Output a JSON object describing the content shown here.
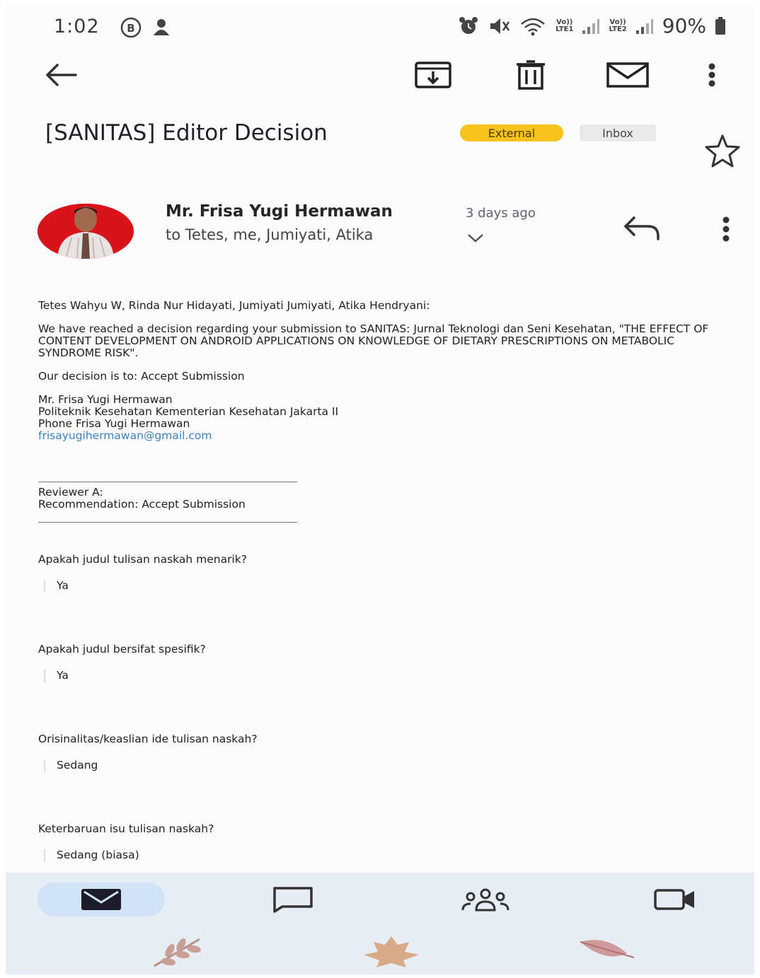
{
  "status_bar": {
    "time": "1:02",
    "sim1": {
      "top": "Vo))",
      "bottom": "LTE1"
    },
    "sim2": {
      "top": "Vo))",
      "bottom": "LTE2"
    },
    "battery": "90%"
  },
  "toolbar": {
    "back": "arrow-left-icon",
    "archive": "archive-icon",
    "delete": "trash-icon",
    "mark_unread": "mail-icon",
    "more": "more-vertical-icon"
  },
  "email": {
    "subject": "[SANITAS] Editor Decision",
    "labels": {
      "external": "External",
      "inbox": "Inbox"
    },
    "sender": {
      "name": "Mr. Frisa Yugi Hermawan",
      "time": "3 days ago",
      "recipients": "to Tetes, me, Jumiyati, Atika"
    },
    "body": {
      "greeting": "Tetes Wahyu W, Rinda Nur Hidayati, Jumiyati Jumiyati, Atika Hendryani:",
      "paragraph": "We have reached a decision regarding your submission to SANITAS: Jurnal Teknologi dan Seni Kesehatan, \"THE EFFECT OF CONTENT DEVELOPMENT ON ANDROID APPLICATIONS ON KNOWLEDGE OF DIETARY PRESCRIPTIONS ON METABOLIC SYNDROME RISK\".",
      "decision": "Our decision is to: Accept Submission",
      "signature": {
        "name": "Mr. Frisa Yugi Hermawan",
        "institution": "Politeknik Kesehatan Kementerian Kesehatan Jakarta II",
        "phone": "Phone Frisa Yugi Hermawan",
        "email": "frisayugihermawan@gmail.com"
      },
      "reviewer": "Reviewer A:",
      "recommendation": "Recommendation: Accept Submission",
      "qa": [
        {
          "question": "Apakah judul tulisan naskah menarik?",
          "answer": "Ya"
        },
        {
          "question": "Apakah judul bersifat spesifik?",
          "answer": "Ya"
        },
        {
          "question": "Orisinalitas/keaslian ide tulisan naskah?",
          "answer": "Sedang"
        },
        {
          "question": "Keterbaruan isu tulisan naskah?",
          "answer": "Sedang (biasa)"
        }
      ]
    }
  },
  "bottom_nav": {
    "items": [
      "mail-icon",
      "chat-icon",
      "spaces-icon",
      "meet-icon"
    ],
    "active": "mail-icon",
    "active_color": "#d0e2f5"
  },
  "colors": {
    "external_badge": "#f8c21c",
    "link": "#3b82c4",
    "avatar_bg": "#d8141a",
    "nav_bg": "#e7edf4"
  }
}
